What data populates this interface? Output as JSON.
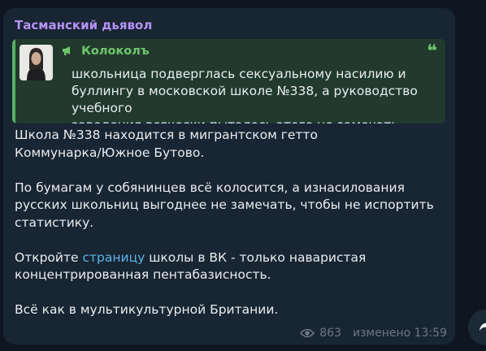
{
  "message": {
    "sender": "Тасманский дьявол",
    "quote": {
      "source": "Колоколъ",
      "source_icon": "megaphone-icon",
      "quote_icon": "quote-mark-icon",
      "quote_mark": "❝",
      "text": "школьница подверглась сексуальному насилию и\nбуллингу в московской школе №338, а руководство учебного\nзаведения всячески пыталось этого не замечать"
    },
    "paragraph1": "Школа №338 находится в мигрантском гетто\nКоммунарка/Южное Бутово.",
    "paragraph2": "По бумагам у собянинцев всё колосится, а изнасилования\nрусских школьниц выгоднее не замечать, чтобы не испортить\nстатистику.",
    "paragraph3": {
      "before": "Откройте ",
      "link": "страницу",
      "after": " школы в ВК - только наваристая\nконцентрированная пентабазисность."
    },
    "paragraph4": "Всё как в мультикультурной Британии.",
    "views": "863",
    "edited_time": "изменено 13:59"
  },
  "colors": {
    "background": "#0e1621",
    "bubble": "#182533",
    "sender": "#b692f6",
    "quote_accent": "#6ec76d",
    "link": "#5cb5e7",
    "meta": "#6c7883"
  }
}
